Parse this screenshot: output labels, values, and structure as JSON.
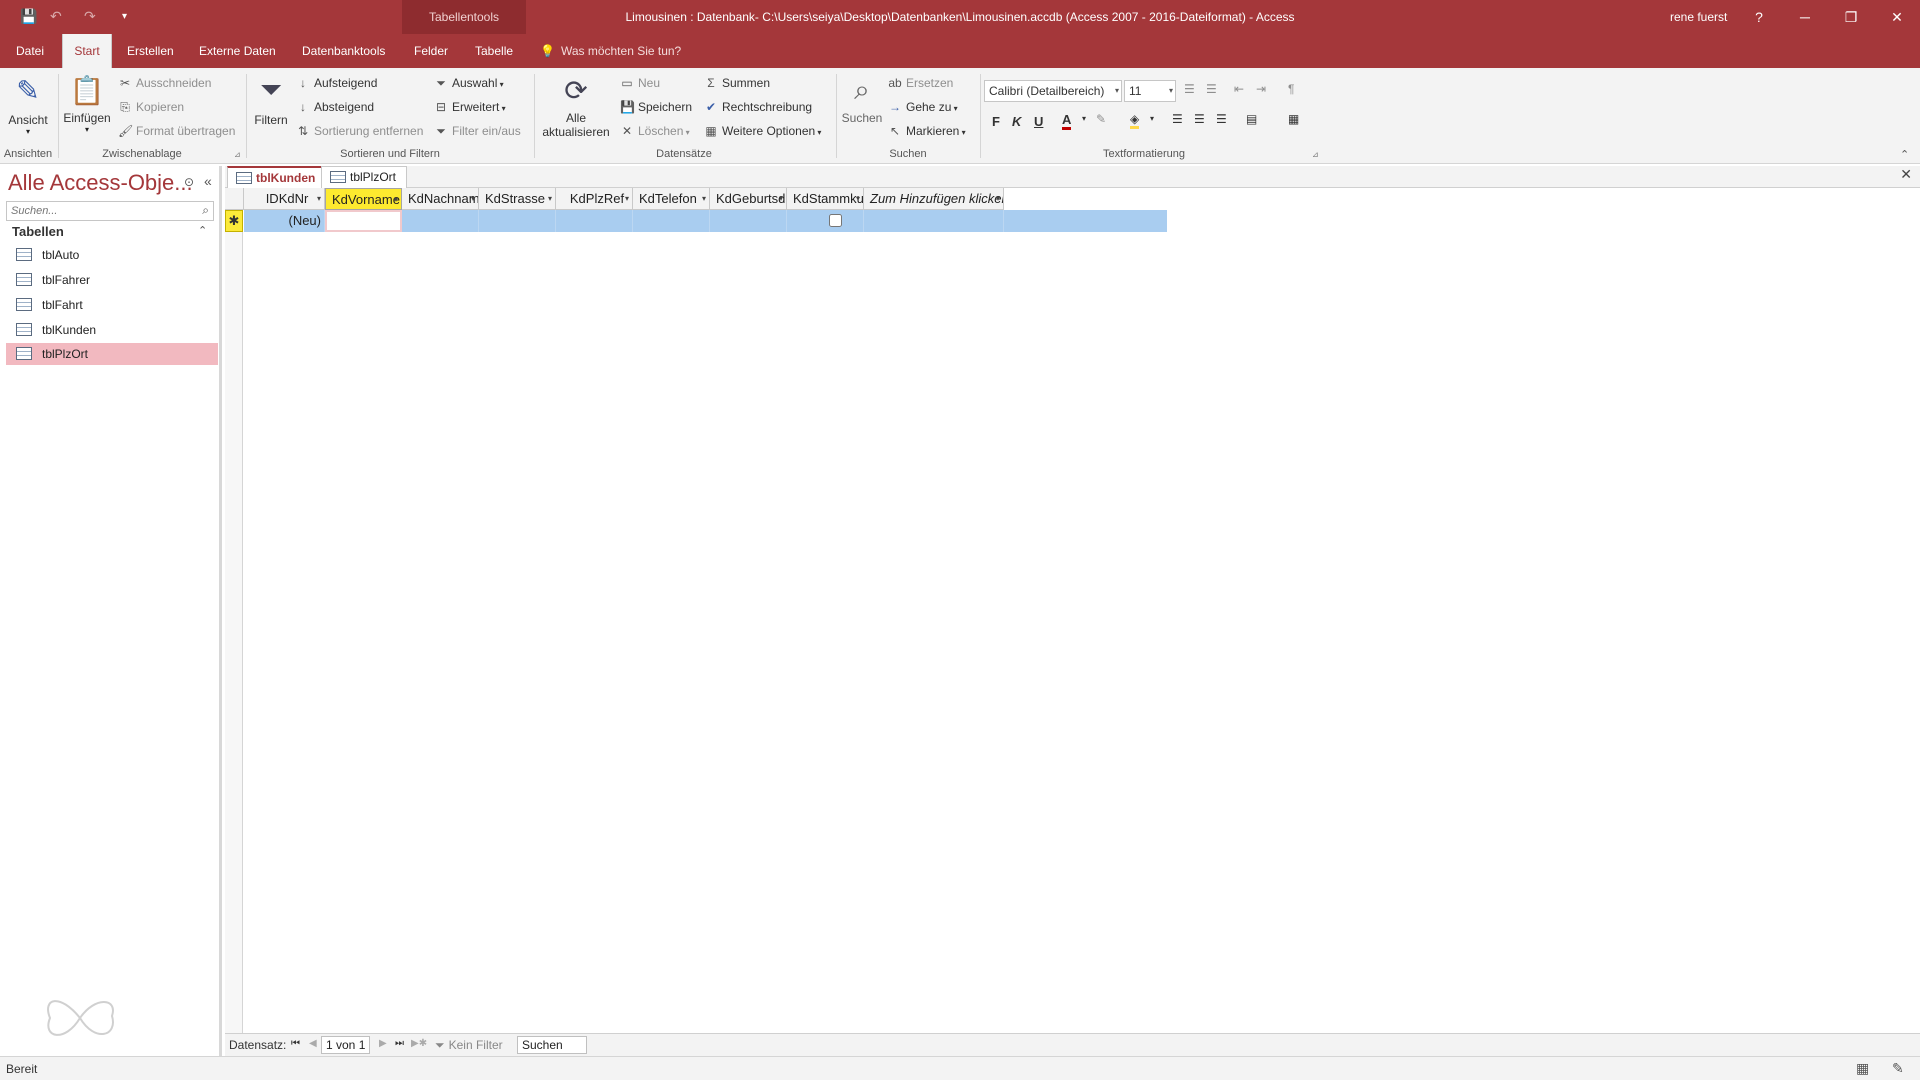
{
  "titlebar": {
    "tool_tab": "Tabellentools",
    "title": "Limousinen : Datenbank- C:\\Users\\seiya\\Desktop\\Datenbanken\\Limousinen.accdb (Access 2007 - 2016-Dateiformat)  -  Access",
    "user": "rene fuerst",
    "help": "?",
    "minimize": "─",
    "restore": "❐",
    "close": "✕",
    "save_icon": "💾",
    "undo_icon": "↶",
    "redo_icon": "↷",
    "customize_icon": "▾"
  },
  "menu": {
    "tabs": [
      "Datei",
      "Start",
      "Erstellen",
      "Externe Daten",
      "Datenbanktools",
      "Felder",
      "Tabelle"
    ],
    "active": "Start",
    "tellme": "Was möchten Sie tun?"
  },
  "ribbon": {
    "ansicht": "Ansicht",
    "einfuegen": "Einfügen",
    "ausschneiden": "Ausschneiden",
    "kopieren": "Kopieren",
    "format_uebertragen": "Format übertragen",
    "filtern": "Filtern",
    "aufsteigend": "Aufsteigend",
    "absteigend": "Absteigend",
    "sortierung_entfernen": "Sortierung entfernen",
    "auswahl": "Auswahl",
    "erweitert": "Erweitert",
    "filter_einaus": "Filter ein/aus",
    "alle": "Alle",
    "aktualisieren": "aktualisieren",
    "neu": "Neu",
    "speichern": "Speichern",
    "loeschen": "Löschen",
    "summen": "Summen",
    "rechtschreibung": "Rechtschreibung",
    "weitere_optionen": "Weitere Optionen",
    "suchen": "Suchen",
    "ersetzen": "Ersetzen",
    "gehe_zu": "Gehe zu",
    "markieren": "Markieren",
    "font": "Calibri (Detailbereich)",
    "font_size": "11",
    "bold": "F",
    "italic": "K",
    "underline": "U",
    "font_color_letter": "A",
    "groups": {
      "ansichten": "Ansichten",
      "zwischenablage": "Zwischenablage",
      "sortieren": "Sortieren und Filtern",
      "datensaetze": "Datensätze",
      "suchen": "Suchen",
      "text": "Textformatierung"
    }
  },
  "nav": {
    "title": "Alle Access-Obje...",
    "search_placeholder": "Suchen...",
    "group": "Tabellen",
    "items": [
      "tblAuto",
      "tblFahrer",
      "tblFahrt",
      "tblKunden",
      "tblPlzOrt"
    ],
    "selected": "tblPlzOrt"
  },
  "doc": {
    "tabs": [
      "tblKunden",
      "tblPlzOrt"
    ],
    "active": "tblKunden",
    "columns": [
      "IDKdNr",
      "KdVorname",
      "KdNachnam",
      "KdStrasse",
      "KdPlzRef",
      "KdTelefon",
      "KdGeburtsd",
      "KdStammku",
      "Zum Hinzufügen klicken"
    ],
    "active_column": "KdVorname",
    "new_row_label": "(Neu)",
    "new_row_marker": "✱"
  },
  "recnav": {
    "label": "Datensatz:",
    "count": "1 von 1",
    "filter": "Kein Filter",
    "search": "Suchen"
  },
  "status": {
    "text": "Bereit"
  },
  "colors": {
    "accent": "#a4373a",
    "active_header": "#fdea2f",
    "new_row": "#a9cdf0",
    "nav_selected": "#f2b9c0"
  }
}
